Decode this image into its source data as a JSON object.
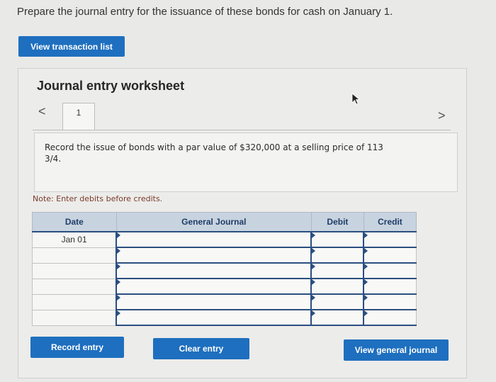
{
  "question": "Prepare the journal entry for the issuance of these bonds for cash on January 1.",
  "view_transaction_list_label": "View transaction list",
  "worksheet": {
    "title": "Journal entry worksheet",
    "nav_prev": "<",
    "nav_next": ">",
    "tab_label": "1",
    "instruction": "Record the issue of bonds with a par value of $320,000 at a selling price of 113 3/4.",
    "note": "Note: Enter debits before credits."
  },
  "table": {
    "headers": {
      "date": "Date",
      "journal": "General Journal",
      "debit": "Debit",
      "credit": "Credit"
    },
    "rows": [
      {
        "date": "Jan 01",
        "journal": "",
        "debit": "",
        "credit": ""
      },
      {
        "date": "",
        "journal": "",
        "debit": "",
        "credit": ""
      },
      {
        "date": "",
        "journal": "",
        "debit": "",
        "credit": ""
      },
      {
        "date": "",
        "journal": "",
        "debit": "",
        "credit": ""
      },
      {
        "date": "",
        "journal": "",
        "debit": "",
        "credit": ""
      },
      {
        "date": "",
        "journal": "",
        "debit": "",
        "credit": ""
      }
    ]
  },
  "buttons": {
    "record_entry": "Record entry",
    "clear_entry": "Clear entry",
    "view_general_journal": "View general journal"
  },
  "colors": {
    "primary_button": "#1e6fbf",
    "header_bg": "#c8d3e0",
    "input_border": "#2b4f80"
  },
  "icons": [
    "cursor-icon",
    "chevron-left-icon",
    "chevron-right-icon"
  ]
}
